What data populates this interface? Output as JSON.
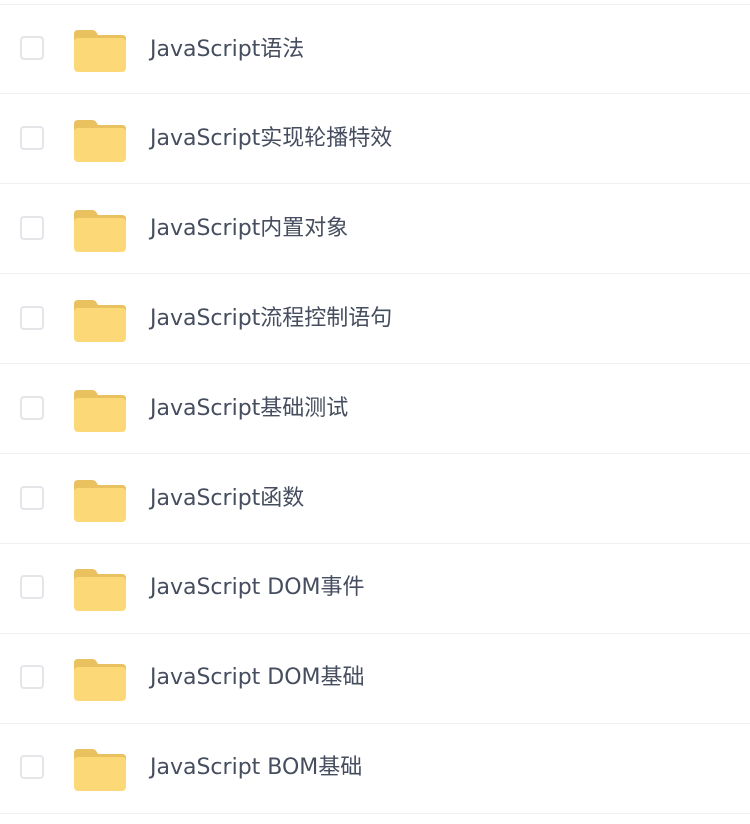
{
  "files": [
    {
      "name": "JavaScript语法",
      "icon": "folder-icon"
    },
    {
      "name": "JavaScript实现轮播特效",
      "icon": "folder-icon"
    },
    {
      "name": "JavaScript内置对象",
      "icon": "folder-icon"
    },
    {
      "name": "JavaScript流程控制语句",
      "icon": "folder-icon"
    },
    {
      "name": "JavaScript基础测试",
      "icon": "folder-icon"
    },
    {
      "name": "JavaScript函数",
      "icon": "folder-icon"
    },
    {
      "name": "JavaScript DOM事件",
      "icon": "folder-icon"
    },
    {
      "name": "JavaScript DOM基础",
      "icon": "folder-icon"
    },
    {
      "name": "JavaScript BOM基础",
      "icon": "folder-icon"
    }
  ],
  "colors": {
    "folder_body": "#fcd976",
    "folder_tab": "#e9c15f",
    "text": "#454d5e",
    "divider": "#eef0f3",
    "checkbox_border": "#e3e5e8"
  }
}
